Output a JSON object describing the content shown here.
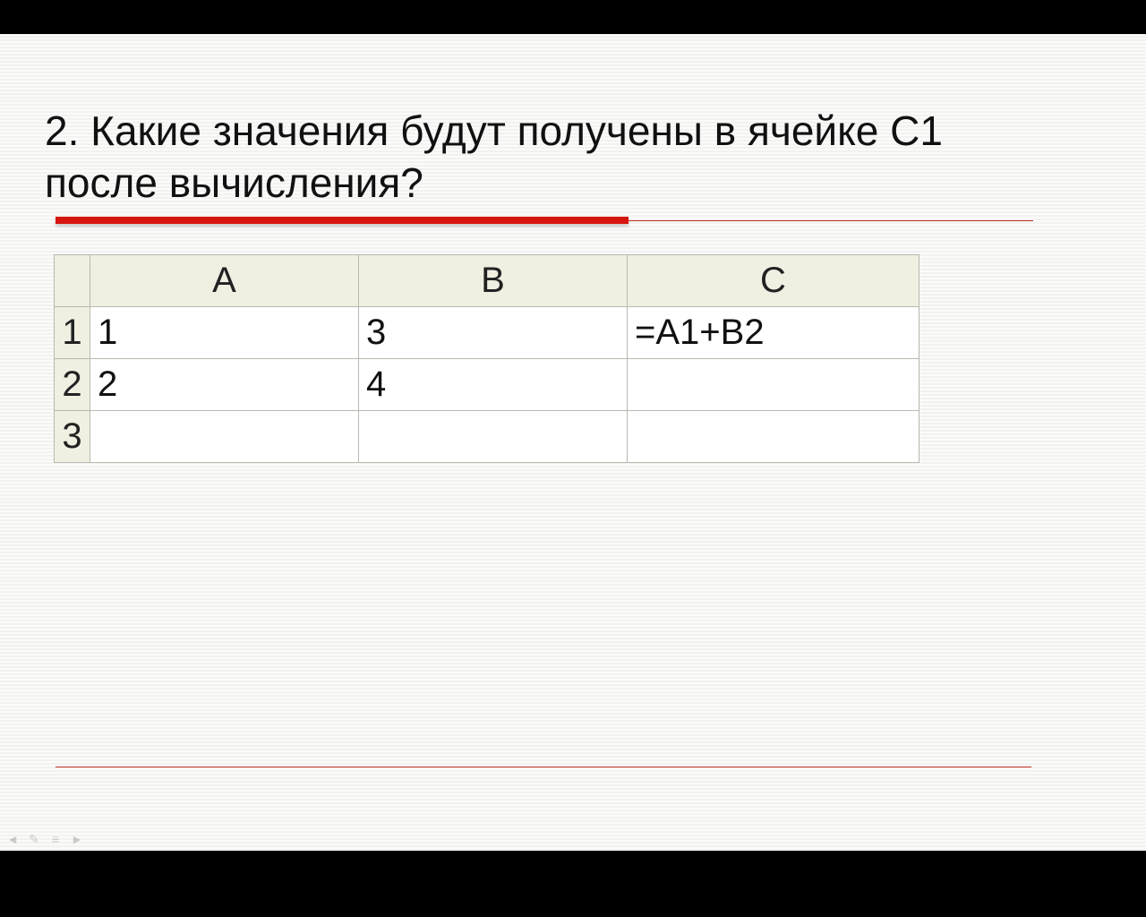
{
  "question": "2. Какие значения будут получены в ячейке С1 после вычисления?",
  "sheet": {
    "columns": [
      "A",
      "B",
      "C"
    ],
    "rows": [
      {
        "n": "1",
        "A": "1",
        "B": "3",
        "C": "=A1+B2"
      },
      {
        "n": "2",
        "A": "2",
        "B": "4",
        "C": ""
      },
      {
        "n": "3",
        "A": "",
        "B": "",
        "C": ""
      }
    ]
  },
  "nav": {
    "prev": "◄",
    "pen": "✎",
    "menu": "≡",
    "next": "►"
  }
}
